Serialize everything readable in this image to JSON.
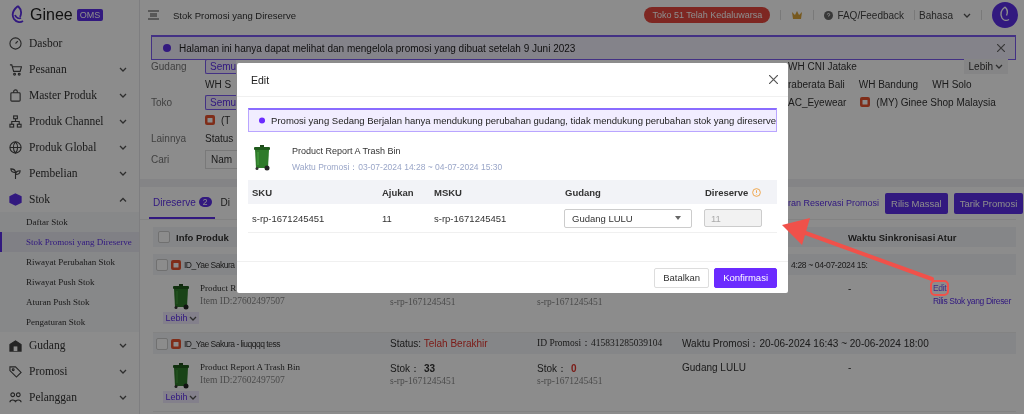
{
  "app": {
    "logo_text": "Ginee",
    "logo_badge": "OMS"
  },
  "sidebar": {
    "items": [
      {
        "label": "Dasbor"
      },
      {
        "label": "Pesanan",
        "expanded": false
      },
      {
        "label": "Master Produk",
        "expanded": false
      },
      {
        "label": "Produk Channel",
        "expanded": false
      },
      {
        "label": "Produk Global",
        "expanded": false
      },
      {
        "label": "Pembelian",
        "expanded": false
      },
      {
        "label": "Stok",
        "expanded": true,
        "children": [
          {
            "label": "Daftar Stok",
            "selected": false
          },
          {
            "label": "Stok Promosi yang Direserve",
            "selected": true
          },
          {
            "label": "Riwayat Perubahan Stok",
            "selected": false
          },
          {
            "label": "Riwayat Push Stok",
            "selected": false
          },
          {
            "label": "Aturan Push Stok",
            "selected": false
          },
          {
            "label": "Pengaturan Stok",
            "selected": false
          }
        ]
      },
      {
        "label": "Gudang",
        "expanded": false
      },
      {
        "label": "Promosi",
        "expanded": false
      },
      {
        "label": "Pelanggan",
        "expanded": false
      }
    ]
  },
  "topbar": {
    "title": "Stok Promosi yang Direserve",
    "expiry_badge": "Toko 51 Telah Kedaluwarsa",
    "help": "FAQ/Feedback",
    "language": "Bahasa"
  },
  "notice": {
    "text": "Halaman ini hanya dapat melihat dan mengelola promosi yang dibuat setelah 9 Juni 2023"
  },
  "filters": [
    {
      "label": "Gudang",
      "left": [
        {
          "label": "Semu",
          "selected": true
        }
      ],
      "right": [
        {
          "label": "WH CNI Jatake",
          "selected": false
        }
      ],
      "more": "Lebih"
    },
    {
      "left": [
        {
          "label": "WH S",
          "selected": false
        }
      ],
      "right": [
        {
          "label": "raberata Bali",
          "selected": false
        },
        {
          "label": "WH Bandung",
          "selected": false
        },
        {
          "label": "WH Solo",
          "selected": false
        }
      ]
    },
    {
      "label": "Toko",
      "left": [
        {
          "label": "Semu",
          "selected": true
        }
      ],
      "right": [
        {
          "label": "AC_Eyewear",
          "selected": false
        },
        {
          "label": "(MY) Ginee Shop Malaysia",
          "selected": false,
          "kind": "shop"
        }
      ]
    },
    {
      "left": [
        {
          "label": "(T",
          "selected": false,
          "kind": "shop"
        }
      ]
    },
    {
      "label": "Lainnya",
      "left": [
        {
          "label": "Status",
          "selected": false
        }
      ]
    },
    {
      "label": "Cari",
      "left": [
        {
          "label": "Nam",
          "kind": "field"
        }
      ]
    }
  ],
  "tabs": [
    {
      "label": "Direserve",
      "count": "2",
      "selected": true
    },
    {
      "label": "Di",
      "selected": false
    }
  ],
  "actions": {
    "link": "ran Reservasi Promosi",
    "buttons": [
      "Rilis Massal",
      "Tarik Promosi"
    ]
  },
  "table": {
    "select_all_checked": false,
    "columns": [
      "Info Produk",
      "Waktu Sinkronisasi",
      "Atur"
    ],
    "groups": [
      {
        "shop": "ID_Yae Sakura",
        "checked": false,
        "promo_time": "4:28 ~ 04-07-2024 15:",
        "product": {
          "name": "Product R",
          "item_id": "Item ID:27602497507",
          "col2": {
            "sku": "s-rp-1671245451"
          },
          "col3": {
            "sku": "s-rp-1671245451"
          },
          "sync": "-",
          "actions": [
            {
              "label": "Edit",
              "highlighted": true
            },
            {
              "label": "Rilis Stok yang Direser",
              "highlighted": false
            }
          ],
          "more": "Lebih"
        }
      },
      {
        "shop": "ID_Yae Sakura - liuqqqq tess",
        "checked": false,
        "status_label": "Status:",
        "status_value": "Telah Berakhir",
        "promo_id": "ID Promosi：415831285039104",
        "promo_time": "Waktu Promosi：20-06-2024 16:43 ~ 20-06-2024 18:00",
        "product": {
          "name": "Product Report A Trash Bin",
          "item_id": "Item ID:27602497507",
          "col2": {
            "stock_label": "Stok：",
            "stock_value": "33",
            "low": false,
            "sku": "s-rp-1671245451"
          },
          "col3": {
            "stock_label": "Stok：",
            "stock_value": "0",
            "low": true,
            "sku": "s-rp-1671245451"
          },
          "warehouse": "Gudang LULU",
          "sync": "-",
          "more": "Lebih"
        }
      }
    ]
  },
  "modal": {
    "title": "Edit",
    "notice": "Promosi yang Sedang Berjalan hanya mendukung perubahan gudang, tidak mendukung perubahan stok yang direserve",
    "product": {
      "name": "Product Report A Trash Bin",
      "promo_time": "Waktu Promosi：03-07-2024 14:28 ~ 04-07-2024 15:30"
    },
    "columns": [
      "SKU",
      "Ajukan",
      "MSKU",
      "Gudang",
      "Direserve"
    ],
    "rows": [
      {
        "sku": "s-rp-1671245451",
        "submitted": "11",
        "msku": "s-rp-1671245451",
        "warehouse": "Gudang LULU",
        "reserved": "11",
        "reserved_disabled": true
      }
    ],
    "buttons": [
      {
        "label": "Batalkan",
        "kind": "secondary"
      },
      {
        "label": "Konfirmasi",
        "kind": "primary"
      }
    ]
  }
}
